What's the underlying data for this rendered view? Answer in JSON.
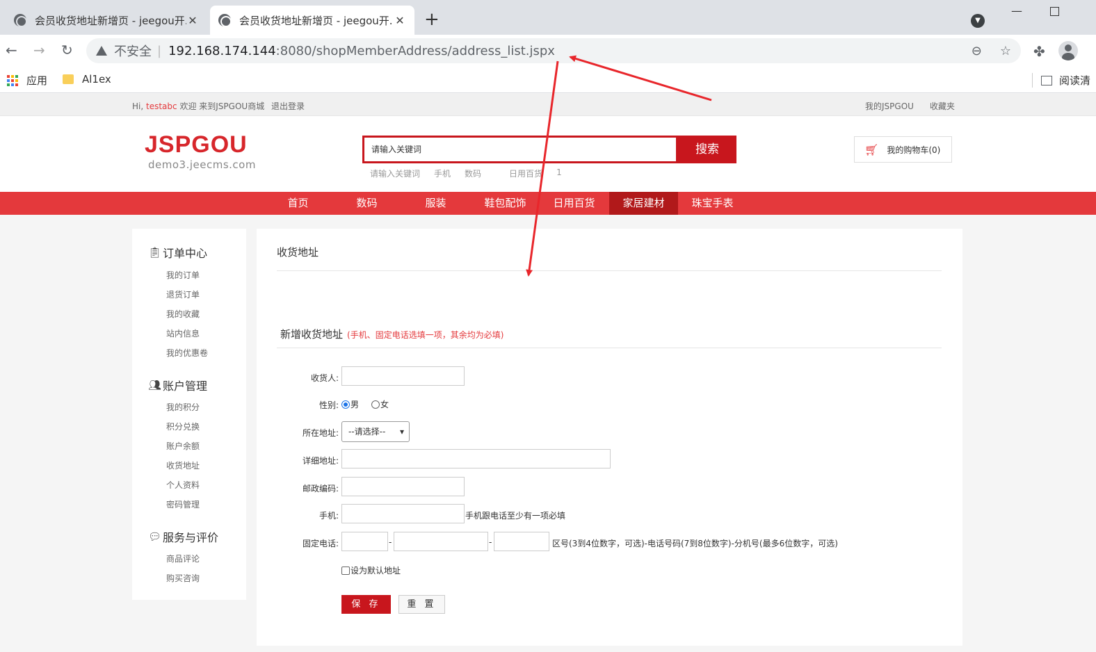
{
  "browser": {
    "tabs": [
      {
        "title": "会员收货地址新增页 - jeegou开...",
        "active": false
      },
      {
        "title": "会员收货地址新增页 - jeegou开...",
        "active": true
      }
    ],
    "new_tab": "+",
    "insecure_label": "不安全",
    "url_host": "192.168.174.144",
    "url_path": ":8080/shopMemberAddress/address_list.jspx",
    "bookmarks": [
      {
        "label": "应用",
        "icon": "apps-grid-icon"
      },
      {
        "label": "Al1ex",
        "icon": "folder-icon"
      }
    ],
    "reading_list": "阅读清"
  },
  "site": {
    "topbar": {
      "hi": "Hi,",
      "username": "testabc",
      "welcome": "欢迎 来到JSPGOU商城",
      "logout": "退出登录",
      "my_shop": "我的JSPGOU",
      "favorites": "收藏夹"
    },
    "header": {
      "logo": "JSPGOU",
      "logo_sub": "demo3.jeecms.com",
      "search_placeholder": "请输入关键词",
      "search_button": "搜索",
      "hot_words": [
        "请输入关键词",
        "手机",
        "数码",
        "日用百货",
        "1"
      ],
      "cart_label": "我的购物车(0)"
    },
    "nav": [
      {
        "label": "首页",
        "active": false
      },
      {
        "label": "数码",
        "active": false
      },
      {
        "label": "服装",
        "active": false
      },
      {
        "label": "鞋包配饰",
        "active": false
      },
      {
        "label": "日用百货",
        "active": false
      },
      {
        "label": "家居建材",
        "active": true
      },
      {
        "label": "珠宝手表",
        "active": false
      }
    ],
    "sidebar": {
      "sections": [
        {
          "title": "订单中心",
          "icon": "order-icon",
          "links": [
            "我的订单",
            "退货订单",
            "我的收藏",
            "站内信息",
            "我的优惠卷"
          ]
        },
        {
          "title": "账户管理",
          "icon": "user-icon",
          "links": [
            "我的积分",
            "积分兑换",
            "账户余额",
            "收货地址",
            "个人资料",
            "密码管理"
          ]
        },
        {
          "title": "服务与评价",
          "icon": "chat-icon",
          "links": [
            "商品评论",
            "购买咨询"
          ]
        }
      ]
    },
    "content": {
      "title": "收货地址",
      "form_title": "新增收货地址",
      "form_note": "(手机、固定电话选填一项，其余均为必填)",
      "labels": {
        "receiver": "收货人:",
        "gender": "性别:",
        "region": "所在地址:",
        "detail": "详细地址:",
        "zip": "邮政编码:",
        "mobile": "手机:",
        "phone": "固定电话:"
      },
      "gender_options": [
        "男",
        "女"
      ],
      "gender_selected": "男",
      "region_value": "--请选择--",
      "mobile_hint": "手机跟电话至少有一项必填",
      "phone_dash": "-",
      "phone_hint": "区号(3到4位数字，可选)-电话号码(7到8位数字)-分机号(最多6位数字，可选)",
      "default_label": "设为默认地址",
      "save_button": "保 存",
      "reset_button": "重 置"
    }
  },
  "annotation_color": "#e8262b"
}
